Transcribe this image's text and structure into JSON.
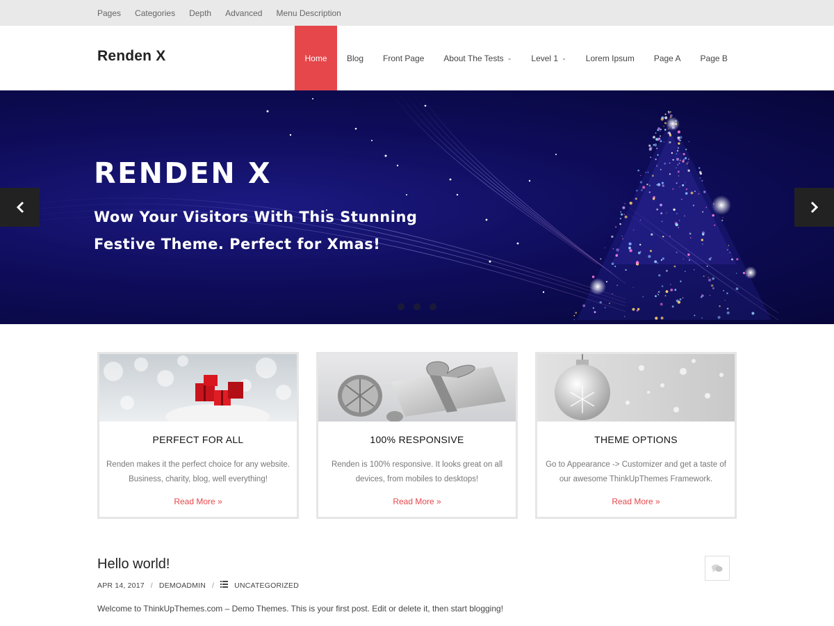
{
  "preheader": {
    "links": [
      "Pages",
      "Categories",
      "Depth",
      "Advanced",
      "Menu Description"
    ]
  },
  "header": {
    "logo": "Renden X",
    "nav": [
      {
        "label": "Home",
        "active": true,
        "dropdown": false
      },
      {
        "label": "Blog",
        "active": false,
        "dropdown": false
      },
      {
        "label": "Front Page",
        "active": false,
        "dropdown": false
      },
      {
        "label": "About The Tests",
        "active": false,
        "dropdown": true
      },
      {
        "label": "Level 1",
        "active": false,
        "dropdown": true
      },
      {
        "label": "Lorem Ipsum",
        "active": false,
        "dropdown": false
      },
      {
        "label": "Page A",
        "active": false,
        "dropdown": false
      },
      {
        "label": "Page B",
        "active": false,
        "dropdown": false
      }
    ],
    "accent_color": "#e5474b"
  },
  "slider": {
    "title": "RENDEN X",
    "text_line1": "Wow Your Visitors With This Stunning",
    "text_line2": "Festive Theme. Perfect for Xmas!",
    "prev_icon": "chevron-left-icon",
    "next_icon": "chevron-right-icon",
    "slide_count": 3
  },
  "features": [
    {
      "title": "PERFECT FOR ALL",
      "text": "Renden makes it the perfect choice for any website. Business, charity, blog, well everything!",
      "link": "Read More »",
      "image": "red-gift-boxes"
    },
    {
      "title": "100% RESPONSIVE",
      "text": "Renden is 100% responsive. It looks great on all devices, from mobiles to desktops!",
      "link": "Read More »",
      "image": "silver-gift-and-pinecone"
    },
    {
      "title": "THEME OPTIONS",
      "text": "Go to Appearance -> Customizer and get a taste of our awesome ThinkUpThemes Framework.",
      "link": "Read More »",
      "image": "silver-ornament-bauble"
    }
  ],
  "post": {
    "title": "Hello world!",
    "date": "APR 14, 2017",
    "author": "DEMOADMIN",
    "category": "UNCATEGORIZED",
    "excerpt": "Welcome to ThinkUpThemes.com – Demo Themes. This is your first post. Edit or delete it, then start blogging!",
    "comment_icon": "comment-icon"
  }
}
